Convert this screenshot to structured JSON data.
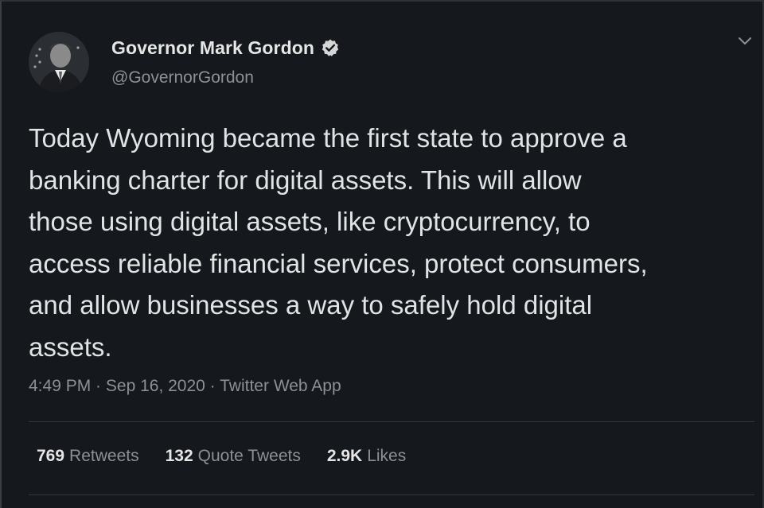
{
  "tweet": {
    "author": {
      "display_name": "Governor Mark Gordon",
      "handle": "@GovernorGordon",
      "verified": true,
      "avatar_icon": "profile-photo"
    },
    "menu_icon": "chevron-down-icon",
    "text": "Today Wyoming became the first state to approve a\nbanking charter for digital assets. This will allow\nthose using digital assets, like cryptocurrency, to\naccess reliable financial services, protect consumers,\nand allow businesses a way to safely hold digital\nassets.",
    "time": "4:49 PM",
    "date": "Sep 16, 2020",
    "source": "Twitter Web App",
    "separator": " · ",
    "stats": {
      "retweets_count": "769",
      "retweets_label": "Retweets",
      "quotes_count": "132",
      "quotes_label": "Quote Tweets",
      "likes_count": "2.9K",
      "likes_label": "Likes"
    }
  },
  "colors": {
    "background": "#15181c",
    "text_primary": "#e1e3e4",
    "text_secondary": "#8b9196",
    "divider": "#33383d"
  }
}
